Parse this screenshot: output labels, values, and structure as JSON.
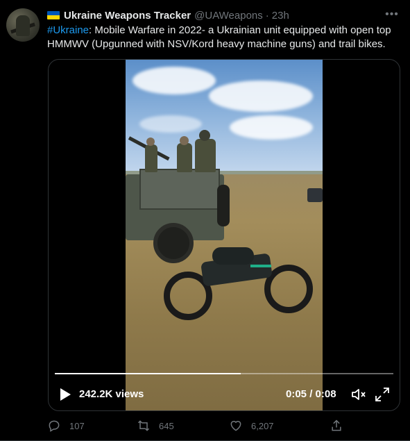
{
  "tweet": {
    "author_name": "Ukraine Weapons Tracker",
    "handle": "@UAWeapons",
    "separator": "·",
    "timestamp": "23h",
    "more_icon": "ellipsis-icon",
    "text_hashtag": "#Ukraine",
    "text_body": ": Mobile Warfare in 2022- a Ukrainian unit equipped with open top HMMWV (Upgunned with NSV/Kord heavy machine guns) and trail bikes."
  },
  "video": {
    "views": "242.2K views",
    "timecode": "0:05 / 0:08",
    "progress": 0.55,
    "play_icon": "play-icon",
    "mute_icon": "volume-muted-icon",
    "fullscreen_icon": "fullscreen-icon"
  },
  "actions": {
    "reply_count": "107",
    "retweet_count": "645",
    "like_count": "6,207",
    "share_icon": "share-icon"
  },
  "colors": {
    "accent": "#1d9bf0",
    "muted": "#71767b",
    "background": "#000000"
  }
}
